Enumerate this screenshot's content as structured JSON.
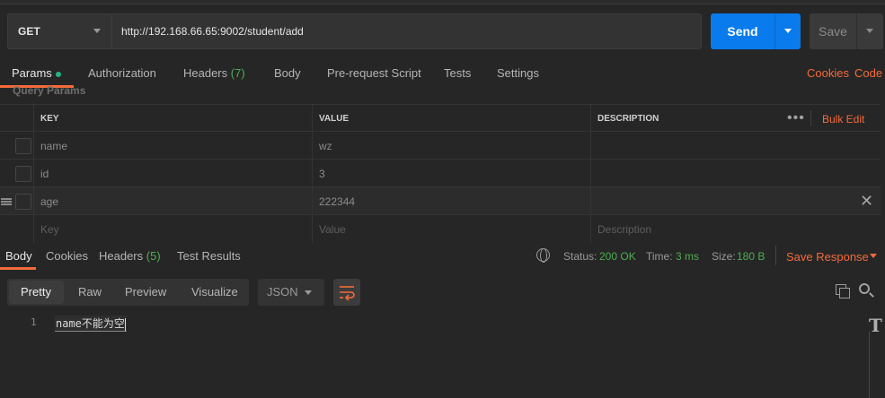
{
  "request": {
    "method": "GET",
    "url": "http://192.168.66.65:9002/student/add",
    "send_label": "Send",
    "save_label": "Save"
  },
  "request_tabs": {
    "params": "Params",
    "authorization": "Authorization",
    "headers": "Headers",
    "headers_count": "(7)",
    "body": "Body",
    "prerequest": "Pre-request Script",
    "tests": "Tests",
    "settings": "Settings",
    "cookies": "Cookies",
    "code": "Code"
  },
  "params": {
    "section_label": "Query Params",
    "headers": {
      "key": "KEY",
      "value": "VALUE",
      "description": "DESCRIPTION",
      "more": "•••",
      "bulk_edit": "Bulk Edit"
    },
    "rows": [
      {
        "key": "name",
        "value": "wz",
        "description": ""
      },
      {
        "key": "id",
        "value": "3",
        "description": ""
      },
      {
        "key": "age",
        "value": "222344",
        "description": ""
      }
    ],
    "placeholders": {
      "key": "Key",
      "value": "Value",
      "description": "Description"
    }
  },
  "response": {
    "tabs": {
      "body": "Body",
      "cookies": "Cookies",
      "headers": "Headers",
      "headers_count": "(5)",
      "test_results": "Test Results"
    },
    "status_label": "Status:",
    "status_value": "200 OK",
    "time_label": "Time:",
    "time_value": "3 ms",
    "size_label": "Size:",
    "size_value": "180 B",
    "save_response": "Save Response",
    "view_modes": {
      "pretty": "Pretty",
      "raw": "Raw",
      "preview": "Preview",
      "visualize": "Visualize"
    },
    "format": "JSON",
    "body_lines": [
      {
        "num": "1",
        "text": "name不能为空"
      }
    ]
  },
  "colors": {
    "accent": "#f26b3a",
    "send": "#097bed",
    "success": "#4caf50"
  }
}
